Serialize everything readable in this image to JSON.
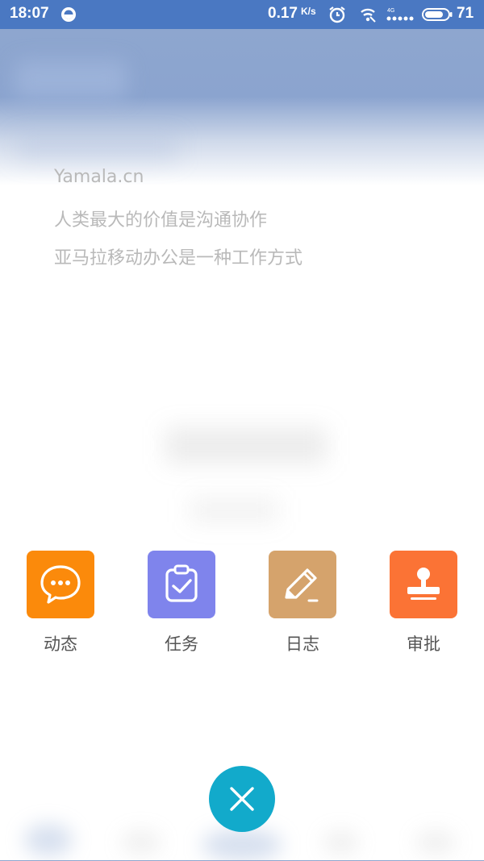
{
  "status_bar": {
    "time": "18:07",
    "net_speed": "0.17",
    "net_speed_unit": "K/s",
    "network_type": "4G",
    "battery_level": "71",
    "bg_color": "#4a78c2"
  },
  "slogan": {
    "line1": "Yamala.cn",
    "line2": "人类最大的价值是沟通协作",
    "line3": "亚马拉移动办公是一种工作方式"
  },
  "actions": [
    {
      "label": "动态",
      "icon": "chat-bubble-icon",
      "color": "#fb8a0b"
    },
    {
      "label": "任务",
      "icon": "clipboard-check-icon",
      "color": "#7f84ec"
    },
    {
      "label": "日志",
      "icon": "pencil-icon",
      "color": "#d5a36c"
    },
    {
      "label": "审批",
      "icon": "stamp-icon",
      "color": "#fb7335"
    }
  ],
  "close_button": {
    "icon": "close-icon",
    "color": "#12aacb"
  }
}
